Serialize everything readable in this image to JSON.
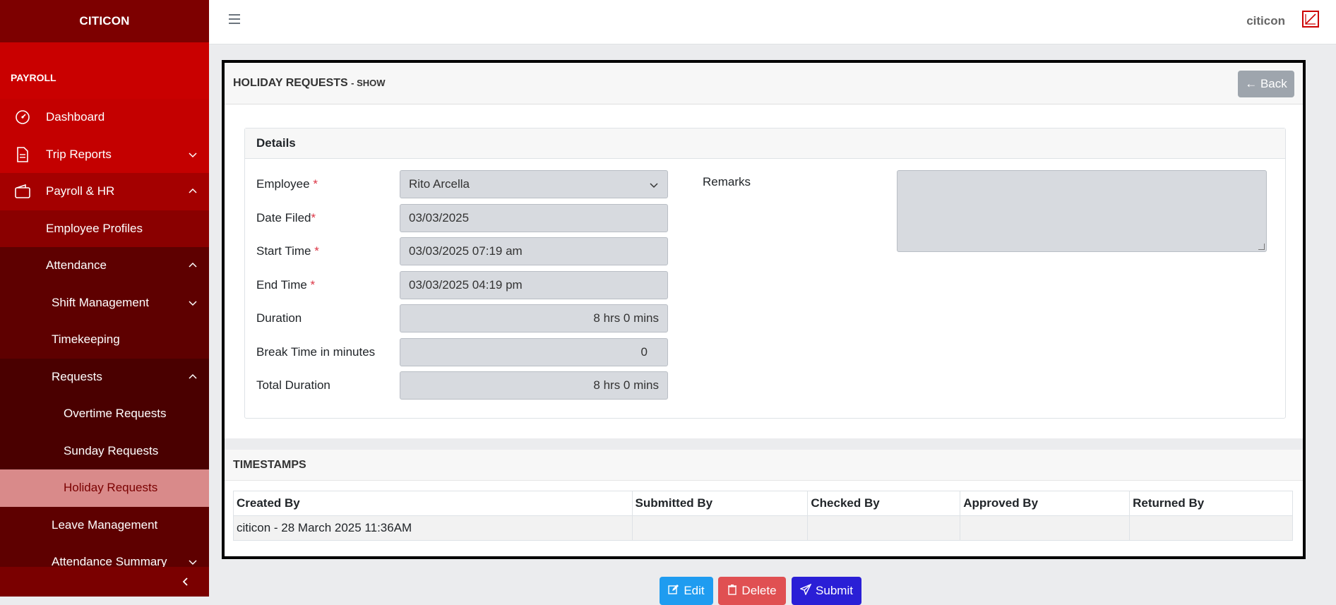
{
  "sidebar": {
    "brand": "CITICON",
    "section": "PAYROLL",
    "items": [
      {
        "label": "Dashboard"
      },
      {
        "label": "Trip Reports"
      },
      {
        "label": "Payroll & HR"
      },
      {
        "label": "Employee Profiles"
      },
      {
        "label": "Attendance"
      },
      {
        "label": "Shift Management"
      },
      {
        "label": "Timekeeping"
      },
      {
        "label": "Requests"
      },
      {
        "label": "Overtime Requests"
      },
      {
        "label": "Sunday Requests"
      },
      {
        "label": "Holiday Requests"
      },
      {
        "label": "Leave Management"
      },
      {
        "label": "Attendance Summary"
      }
    ]
  },
  "topbar": {
    "username": "citicon"
  },
  "page": {
    "title": "HOLIDAY REQUESTS",
    "subtitle": "- SHOW",
    "back_label": "← Back"
  },
  "details": {
    "title": "Details",
    "employee_label": "Employee",
    "employee_value": "Rito Arcella",
    "date_filed_label": "Date Filed",
    "date_filed_value": "03/03/2025",
    "start_time_label": "Start Time",
    "start_time_value": "03/03/2025 07:19 am",
    "end_time_label": "End Time",
    "end_time_value": "03/03/2025 04:19 pm",
    "duration_label": "Duration",
    "duration_value": "8 hrs 0 mins",
    "break_label": "Break Time in minutes",
    "break_value": "0",
    "total_label": "Total Duration",
    "total_value": "8 hrs 0 mins",
    "remarks_label": "Remarks",
    "required_mark": "*"
  },
  "timestamps": {
    "title": "TIMESTAMPS",
    "headers": [
      "Created By",
      "Submitted By",
      "Checked By",
      "Approved By",
      "Returned By"
    ],
    "row": [
      "citicon - 28 March 2025 11:36AM",
      "",
      "",
      "",
      ""
    ]
  },
  "actions": {
    "edit": "Edit",
    "delete": "Delete",
    "submit": "Submit"
  },
  "colors": {
    "sidebar_bg": "#8a0000",
    "sidebar_active": "#d98a8a",
    "accent_edit": "#1f9cf0",
    "accent_delete": "#e05052",
    "accent_submit": "#2a1fd6"
  }
}
